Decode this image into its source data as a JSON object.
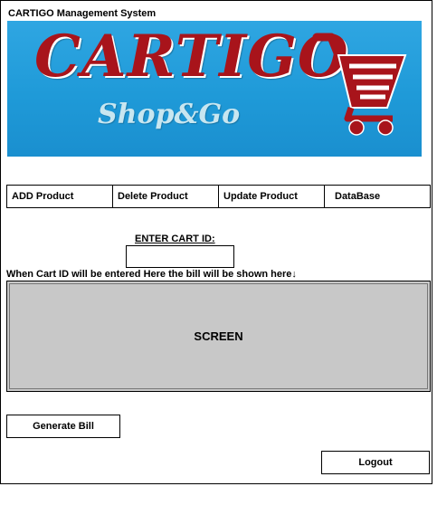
{
  "window": {
    "title": "CARTIGO Management System"
  },
  "banner": {
    "brand": "CARTIGO",
    "tagline": "Shop&Go",
    "colors": {
      "background": "#1f9ad8",
      "brand": "#a8141b",
      "tagline": "#c8e6f0"
    },
    "icon": "shopping-cart-icon"
  },
  "menu": {
    "tabs": [
      {
        "label": "ADD Product"
      },
      {
        "label": "Delete Product"
      },
      {
        "label": "Update Product"
      },
      {
        "label": "DataBase"
      }
    ]
  },
  "cart": {
    "label": "ENTER CART ID:",
    "value": "",
    "placeholder": ""
  },
  "hint": "When Cart ID will be entered Here the bill will be shown here↓",
  "screen": {
    "label": "SCREEN",
    "color": "#c8c8c8"
  },
  "actions": {
    "generate_label": "Generate Bill",
    "logout_label": "Logout"
  }
}
